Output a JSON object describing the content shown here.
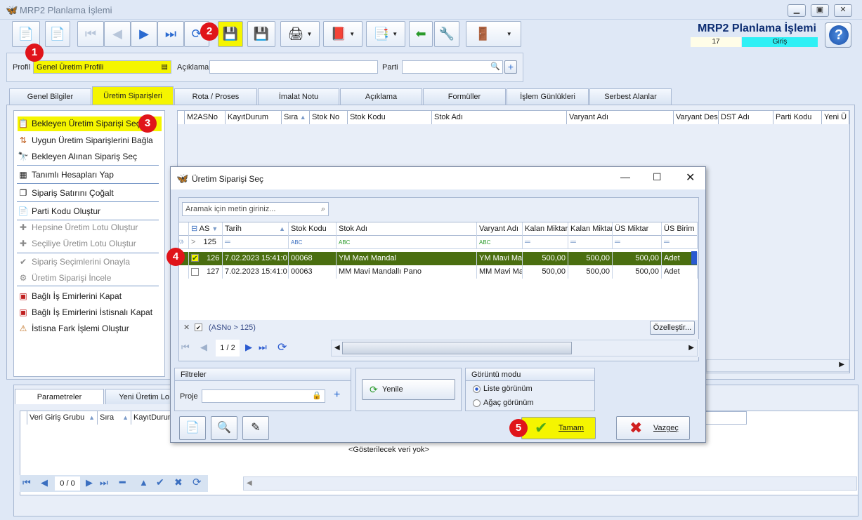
{
  "window": {
    "title": "MRP2 Planlama İşlemi",
    "minimize": "▭",
    "restore": "▣",
    "close": "✕"
  },
  "header": {
    "app_title": "MRP2 Planlama İşlemi",
    "record_no": "17",
    "mode": "Giriş",
    "help": "?"
  },
  "profile_panel": {
    "profil_label": "Profil",
    "profil_value": "Genel Üretim Profili",
    "aciklama_label": "Açıklama",
    "aciklama_value": "",
    "parti_label": "Parti",
    "parti_value": ""
  },
  "main_tabs": [
    "Genel Bilgiler",
    "Üretim Siparişleri",
    "Rota / Proses",
    "İmalat Notu",
    "Açıklama",
    "Formüller",
    "İşlem Günlükleri",
    "Serbest Alanlar"
  ],
  "side_menu": [
    {
      "label": "Bekleyen Üretim Siparişi Seç",
      "icon": "clipboard-icon"
    },
    {
      "label": "Uygun Üretim Siparişlerini Bağla",
      "icon": "sort-az-icon"
    },
    {
      "label": "Bekleyen Alınan Sipariş Seç",
      "icon": "binoculars-icon"
    },
    {
      "label": "Tanımlı Hesapları Yap",
      "icon": "calculator-icon"
    },
    {
      "label": "Sipariş Satırını Çoğalt",
      "icon": "copy-icon"
    },
    {
      "label": "Parti Kodu Oluştur",
      "icon": "document-icon"
    },
    {
      "label": "Hepsine Üretim Lotu Oluştur",
      "icon": "plus-icon"
    },
    {
      "label": "Seçiliye Üretim Lotu Oluştur",
      "icon": "plus-icon"
    },
    {
      "label": "Sipariş Seçimlerini Onayla",
      "icon": "check-icon"
    },
    {
      "label": "Üretim Siparişi İncele",
      "icon": "inspect-icon"
    },
    {
      "label": "Bağlı İş Emirlerini Kapat",
      "icon": "close-orders-icon"
    },
    {
      "label": "Bağlı İş Emirlerini İstisnalı Kapat",
      "icon": "close-orders-icon"
    },
    {
      "label": "İstisna Fark İşlemi Oluştur",
      "icon": "exception-icon"
    }
  ],
  "main_grid_columns": [
    "M2ASNo",
    "KayıtDurum",
    "Sıra",
    "Stok No",
    "Stok Kodu",
    "Stok Adı",
    "Varyant Adı",
    "Varyant Des",
    "DST Adı",
    "Parti Kodu",
    "Yeni Ü"
  ],
  "bottom_tabs": [
    "Parametreler",
    "Yeni Üretim Lo"
  ],
  "bottom_grid": {
    "columns": [
      "Veri Giriş Grubu",
      "Sıra",
      "KayıtDurum"
    ],
    "empty_text": "<Gösterilecek veri yok>",
    "page_indicator": "0 / 0"
  },
  "dialog": {
    "title": "Üretim Siparişi Seç",
    "search_placeholder": "Aramak için metin giriniz...",
    "columns": [
      "AS",
      "Tarih",
      "Stok Kodu",
      "Stok Adı",
      "Varyant Adı",
      "Kalan Miktar",
      "Kalan Miktar",
      "ÜS Miktar",
      "ÜS Birim"
    ],
    "filter_row": {
      "as": "125"
    },
    "rows": [
      {
        "checked": true,
        "as": "126",
        "tarih": "7.02.2023 15:41:0",
        "stok_kodu": "00068",
        "stok_adi": "YM Mavi Mandal",
        "varyant": "YM Mavi Man",
        "kalan1": "500,00",
        "kalan2": "500,00",
        "us_miktar": "500,00",
        "us_birim": "Adet"
      },
      {
        "checked": false,
        "as": "127",
        "tarih": "7.02.2023 15:41:0",
        "stok_kodu": "00063",
        "stok_adi": "MM Mavi Mandallı Pano",
        "varyant": "MM Mavi Mar",
        "kalan1": "500,00",
        "kalan2": "500,00",
        "us_miktar": "500,00",
        "us_birim": "Adet"
      }
    ],
    "filter_expression": "(ASNo > 125)",
    "customize_button": "Özelleştir...",
    "page_indicator": "1 / 2",
    "filters_group": {
      "title": "Filtreler",
      "proje_label": "Proje"
    },
    "refresh_button": "Yenile",
    "view_mode": {
      "title": "Görüntü modu",
      "options": [
        "Liste görünüm",
        "Ağaç görünüm"
      ],
      "selected": "Liste görünüm"
    },
    "ok_button": "Tamam",
    "cancel_button": "Vazgeç"
  },
  "callouts": [
    "1",
    "2",
    "3",
    "4",
    "5"
  ],
  "colors": {
    "highlight": "#f5f500",
    "selected_row": "#4a6e10",
    "accent_blue": "#0e2e73",
    "mode_badge": "#2ff0f5",
    "callout": "#e0141a"
  }
}
